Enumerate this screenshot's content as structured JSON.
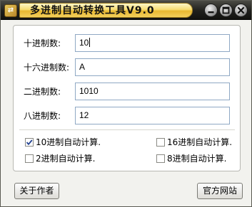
{
  "window": {
    "title": "多进制自动转换工具V9.0",
    "icon": "app-icon",
    "controls": [
      "minimize-icon",
      "maximize-icon",
      "close-icon"
    ]
  },
  "fields": {
    "decimal": {
      "label": "十进制数:",
      "value": "10"
    },
    "hex": {
      "label": "十六进制数:",
      "value": "A"
    },
    "binary": {
      "label": "二进制数:",
      "value": "1010"
    },
    "octal": {
      "label": "八进制数:",
      "value": "12"
    }
  },
  "options": {
    "auto_dec": {
      "label": "10进制自动计算.",
      "checked": true
    },
    "auto_hex": {
      "label": "16进制自动计算.",
      "checked": false
    },
    "auto_bin": {
      "label": "2进制自动计算.",
      "checked": false
    },
    "auto_oct": {
      "label": "8进制自动计算.",
      "checked": false
    }
  },
  "buttons": {
    "about": "关于作者",
    "website": "官方网站"
  },
  "colors": {
    "title_plate": "#f6dc70",
    "titlebar": "#1f1f1c",
    "input_border": "#8fa8c4"
  }
}
